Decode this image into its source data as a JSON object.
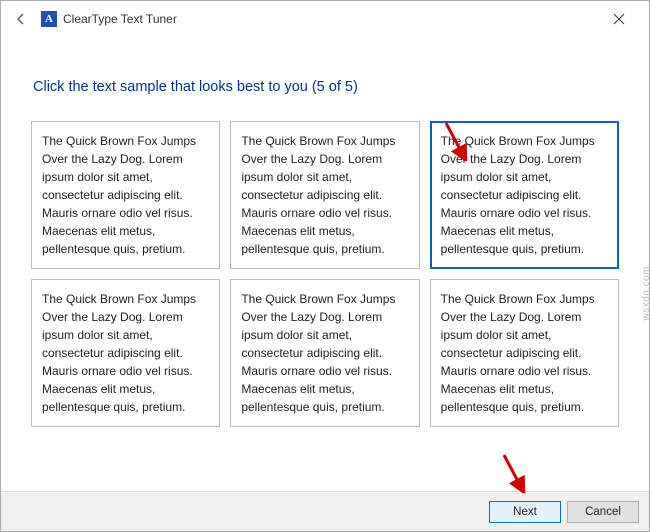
{
  "titlebar": {
    "app_title": "ClearType Text Tuner"
  },
  "instruction": "Click the text sample that looks best to you (5 of 5)",
  "sample_text": "The Quick Brown Fox Jumps Over the Lazy Dog. Lorem ipsum dolor sit amet, consectetur adipiscing elit. Mauris ornare odio vel risus. Maecenas elit metus, pellentesque quis, pretium.",
  "samples": [
    {
      "selected": false
    },
    {
      "selected": false
    },
    {
      "selected": true
    },
    {
      "selected": false
    },
    {
      "selected": false
    },
    {
      "selected": false
    }
  ],
  "footer": {
    "next": "Next",
    "cancel": "Cancel"
  },
  "watermark": "wsxdn.com"
}
